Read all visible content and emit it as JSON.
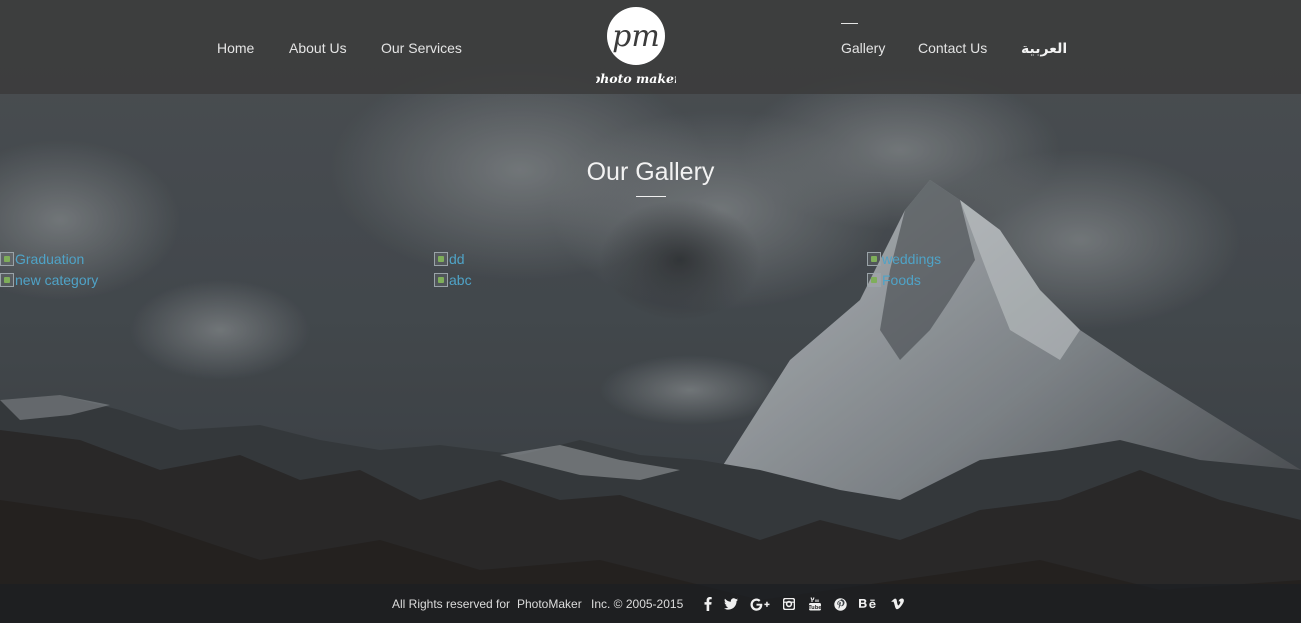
{
  "nav": {
    "items": [
      {
        "label": "Home"
      },
      {
        "label": "About Us"
      },
      {
        "label": "Our Services"
      },
      {
        "label": "Gallery"
      },
      {
        "label": "Contact Us"
      },
      {
        "label": "العربية"
      }
    ],
    "active": "Gallery"
  },
  "logo": {
    "monogram": "pm",
    "wordmark": "photo maker"
  },
  "gallery": {
    "title": "Our Gallery",
    "items": [
      {
        "label": "Graduation"
      },
      {
        "label": "new category"
      },
      {
        "label": "dd"
      },
      {
        "label": "abc"
      },
      {
        "label": "weddings"
      },
      {
        "label": "Foods"
      }
    ]
  },
  "footer": {
    "rights": "All Rights reserved for",
    "company": "PhotoMaker",
    "copyright": "Inc. © 2005-2015",
    "social_icons": [
      "facebook-icon",
      "twitter-icon",
      "google-plus-icon",
      "instagram-icon",
      "youtube-icon",
      "pinterest-icon",
      "behance-icon",
      "vimeo-icon"
    ]
  },
  "colors": {
    "link": "#4fa3c7",
    "header_bg": "#3a3a3a",
    "footer_bg": "#1c1e22"
  }
}
